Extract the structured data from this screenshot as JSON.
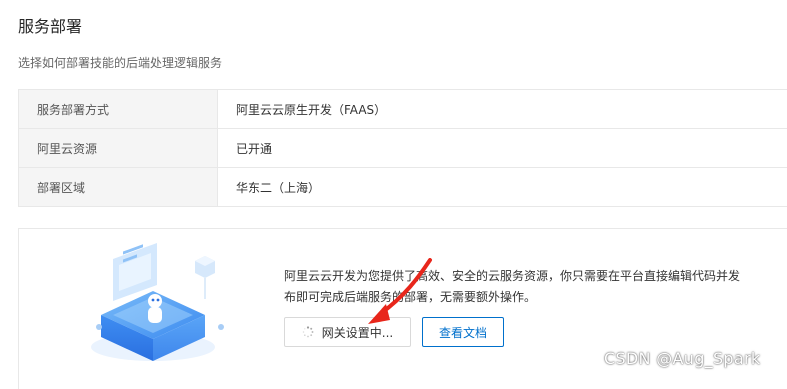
{
  "header": {
    "title": "服务部署",
    "description": "选择如何部署技能的后端处理逻辑服务"
  },
  "info_table": {
    "rows": [
      {
        "label": "服务部署方式",
        "value": "阿里云云原生开发（FAAS）"
      },
      {
        "label": "阿里云资源",
        "value": "已开通"
      },
      {
        "label": "部署区域",
        "value": "华东二（上海）"
      }
    ]
  },
  "deploy_panel": {
    "text_line1": "阿里云云开发为您提供了高效、安全的云服务资源，你只需要在平台直接编辑代码并发",
    "text_line2": "布即可完成后端服务的部署，无需要额外操作。",
    "gateway_button_label": "网关设置中...",
    "docs_button_label": "查看文档",
    "icons": {
      "illustration": "cloud-server-robot-illustration",
      "spinner": "loading-spinner-icon",
      "annotation": "red-arrow-icon"
    }
  },
  "watermark": "CSDN @Aug_Spark",
  "colors": {
    "accent": "#0070cc",
    "label_bg": "#f5f5f5",
    "border": "#e8e8e8",
    "annotation_arrow": "#e8261b"
  }
}
